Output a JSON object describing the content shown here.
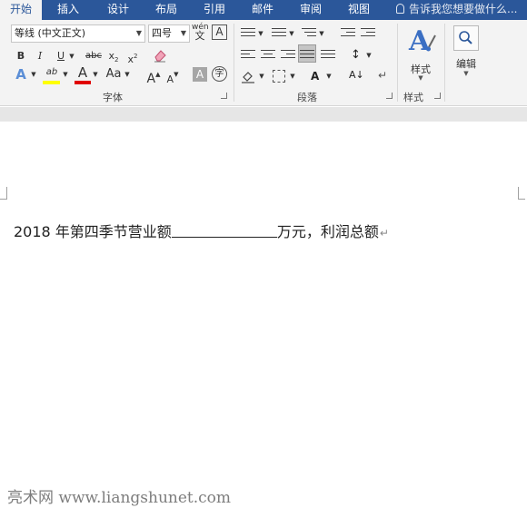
{
  "tabs": [
    "开始",
    "插入",
    "设计",
    "布局",
    "引用",
    "邮件",
    "审阅",
    "视图"
  ],
  "active_tab": "开始",
  "tell_me": "告诉我您想要做什么...",
  "font_group": {
    "font_name": "等线 (中文正文)",
    "font_size": "四号",
    "phonetic_guide": "wén",
    "phonetic_char": "文",
    "enclose_box_char": "A",
    "bold": "B",
    "italic": "I",
    "underline": "U",
    "strikethrough": "abc",
    "subscript": "x",
    "subscript_suffix": "2",
    "superscript": "x",
    "superscript_suffix": "2",
    "text_effects": "A",
    "highlight": "ab",
    "font_color": "A",
    "change_case": "Aa",
    "grow_font": "A",
    "shrink_font": "A",
    "char_shading": "A",
    "enclose_char": "字",
    "label": "字体",
    "highlight_color": "#ffff00",
    "font_color_bar": "#e00000"
  },
  "paragraph_group": {
    "label": "段落"
  },
  "styles_group": {
    "styles_button": "样式",
    "label": "样式"
  },
  "editing_group": {
    "editing_button": "编辑"
  },
  "document": {
    "text_before": "2018 年第四季节营业额",
    "text_after": "万元，利润总额",
    "paragraph_mark": "↵"
  },
  "watermark": "亮术网 www.liangshunet.com"
}
